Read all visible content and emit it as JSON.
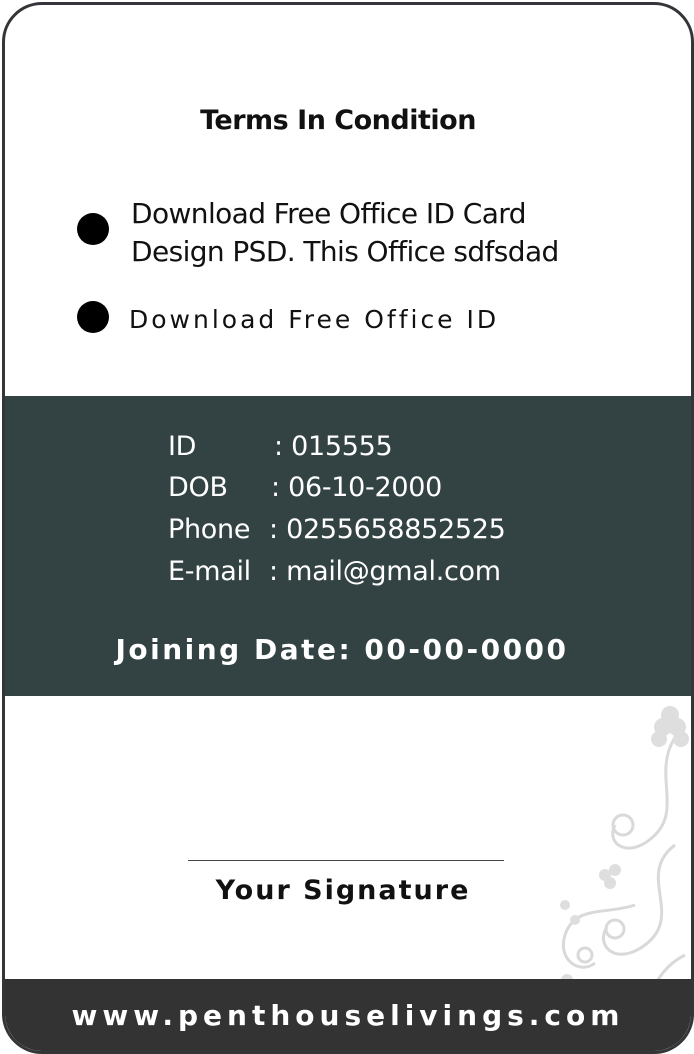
{
  "terms": {
    "title": "Terms In Condition",
    "items": [
      {
        "line1": "Download Free Office ID Card",
        "line2": "Design PSD. This Office sdfsdad"
      },
      {
        "line1": "Download Free Office ID"
      }
    ]
  },
  "info": {
    "rows": [
      {
        "label": "ID",
        "value": ": 015555"
      },
      {
        "label": "DOB",
        "value": ": 06-10-2000"
      },
      {
        "label": "Phone",
        "value": ": 0255658852525"
      },
      {
        "label": "E-mail",
        "value": ": mail@gmal.com"
      }
    ],
    "joining": "Joining Date: 00-00-0000"
  },
  "signature": {
    "label": "Your Signature"
  },
  "footer": {
    "website": "www.penthouselivings.com"
  },
  "colors": {
    "info_band": "#334343",
    "footer": "#333333",
    "border": "#333538",
    "floral": "#d9d9d9"
  }
}
